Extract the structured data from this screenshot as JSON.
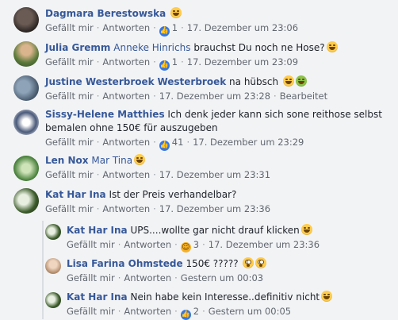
{
  "comments": [
    {
      "author": "Dagmara Berestowska",
      "mention": "",
      "text": "",
      "emoji": "laughing",
      "like_label": "Gefällt mir",
      "reply_label": "Antworten",
      "reaction_icon": "like-icon",
      "reaction_count": "1",
      "timestamp": "17. Dezember um 23:06",
      "edited": ""
    },
    {
      "author": "Julia Gremm",
      "mention": "Anneke Hinrichs",
      "text": "brauchst Du noch ne Hose?",
      "emoji": "laughing",
      "like_label": "Gefällt mir",
      "reply_label": "Antworten",
      "reaction_icon": "like-icon",
      "reaction_count": "1",
      "timestamp": "17. Dezember um 23:09",
      "edited": ""
    },
    {
      "author": "Justine Westerbroek",
      "mention": "Westerbroek",
      "text": "na hübsch",
      "emoji": "laughing,sick",
      "like_label": "Gefällt mir",
      "reply_label": "Antworten",
      "reaction_icon": "",
      "reaction_count": "",
      "timestamp": "17. Dezember um 23:28",
      "edited": "Bearbeitet"
    },
    {
      "author": "Sissy-Helene Matthies",
      "mention": "",
      "text": "Ich denk jeder kann sich sone reithose selbst",
      "text2": "bemalen ohne 150€ für auszugeben",
      "emoji": "",
      "like_label": "Gefällt mir",
      "reply_label": "Antworten",
      "reaction_icon": "like-icon",
      "reaction_count": "41",
      "timestamp": "17. Dezember um 23:29",
      "edited": ""
    },
    {
      "author": "Len Nox",
      "mention": "Mar Tina",
      "text": "",
      "emoji": "laughing",
      "like_label": "Gefällt mir",
      "reply_label": "Antworten",
      "reaction_icon": "",
      "reaction_count": "",
      "timestamp": "17. Dezember um 23:31",
      "edited": ""
    },
    {
      "author": "Kat Har Ina",
      "mention": "",
      "text": "Ist der Preis verhandelbar?",
      "emoji": "",
      "like_label": "Gefällt mir",
      "reply_label": "Antworten",
      "reaction_icon": "",
      "reaction_count": "",
      "timestamp": "17. Dezember um 23:36",
      "edited": ""
    }
  ],
  "replies": [
    {
      "author": "Kat Har Ina",
      "mention": "",
      "text": "UPS....wollte gar nicht drauf klicken",
      "emoji": "laughing",
      "like_label": "Gefällt mir",
      "reply_label": "Antworten",
      "reaction_icon": "haha-icon",
      "reaction_count": "3",
      "timestamp": "17. Dezember um 23:36"
    },
    {
      "author": "Lisa Farina Ohmstede",
      "mention": "",
      "text": "150€ ?????",
      "emoji": "flushed,flushed",
      "like_label": "Gefällt mir",
      "reply_label": "Antworten",
      "reaction_icon": "",
      "reaction_count": "",
      "timestamp": "Gestern um 00:03"
    },
    {
      "author": "Kat Har Ina",
      "mention": "",
      "text": "Nein habe kein Interesse..definitiv nicht",
      "emoji": "laughing",
      "like_label": "Gefällt mir",
      "reply_label": "Antworten",
      "reaction_icon": "like-icon",
      "reaction_count": "2",
      "timestamp": "Gestern um 00:05"
    }
  ],
  "colors": {
    "author": "#365899",
    "meta": "#616770",
    "background": "#f2f3f5",
    "like": "#3578e5"
  }
}
